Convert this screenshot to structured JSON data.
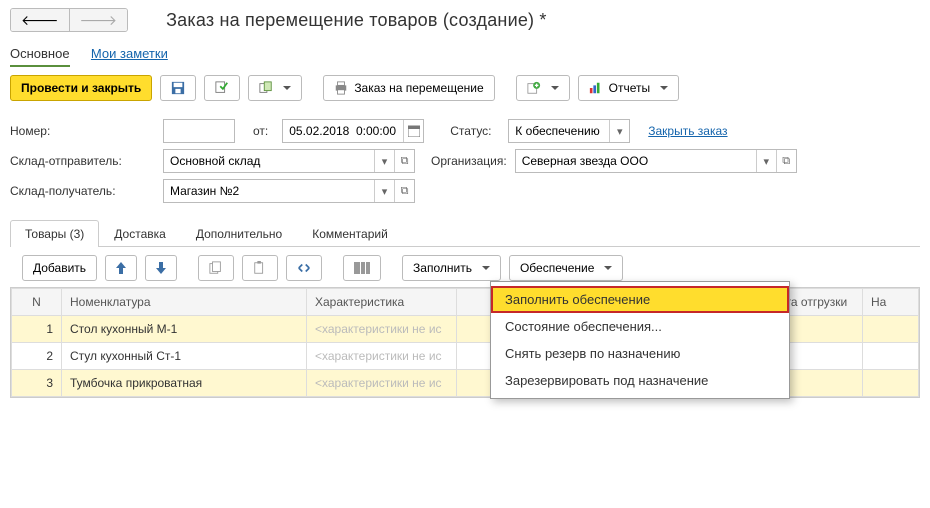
{
  "title": "Заказ на перемещение товаров (создание) *",
  "subtabs": {
    "main": "Основное",
    "notes": "Мои заметки"
  },
  "toolbar": {
    "post_close": "Провести и закрыть",
    "print": "Заказ на перемещение",
    "reports": "Отчеты"
  },
  "form": {
    "number_label": "Номер:",
    "from_label": "от:",
    "date_value": "05.02.2018  0:00:00",
    "status_label": "Статус:",
    "status_value": "К обеспечению",
    "close_order": "Закрыть заказ",
    "warehouse_from_label": "Склад-отправитель:",
    "warehouse_from_value": "Основной склад",
    "org_label": "Организация:",
    "org_value": "Северная звезда ООО",
    "warehouse_to_label": "Склад-получатель:",
    "warehouse_to_value": "Магазин №2"
  },
  "tabs": {
    "goods": "Товары (3)",
    "delivery": "Доставка",
    "extra": "Дополнительно",
    "comment": "Комментарий"
  },
  "grid_toolbar": {
    "add": "Добавить",
    "fill": "Заполнить",
    "supply": "Обеспечение"
  },
  "columns": {
    "n": "N",
    "item": "Номенклатура",
    "char": "Характеристика",
    "ship": "Дата отгрузки",
    "na": "На"
  },
  "rows": [
    {
      "n": "1",
      "item": "Стол кухонный М-1",
      "char": "<характеристики не ис"
    },
    {
      "n": "2",
      "item": "Стул кухонный Ст-1",
      "char": "<характеристики не ис"
    },
    {
      "n": "3",
      "item": "Тумбочка прикроватная",
      "char": "<характеристики не ис"
    }
  ],
  "dropdown": {
    "i1": "Заполнить обеспечение",
    "i2": "Состояние обеспечения...",
    "i3": "Снять резерв по назначению",
    "i4": "Зарезервировать под назначение"
  }
}
